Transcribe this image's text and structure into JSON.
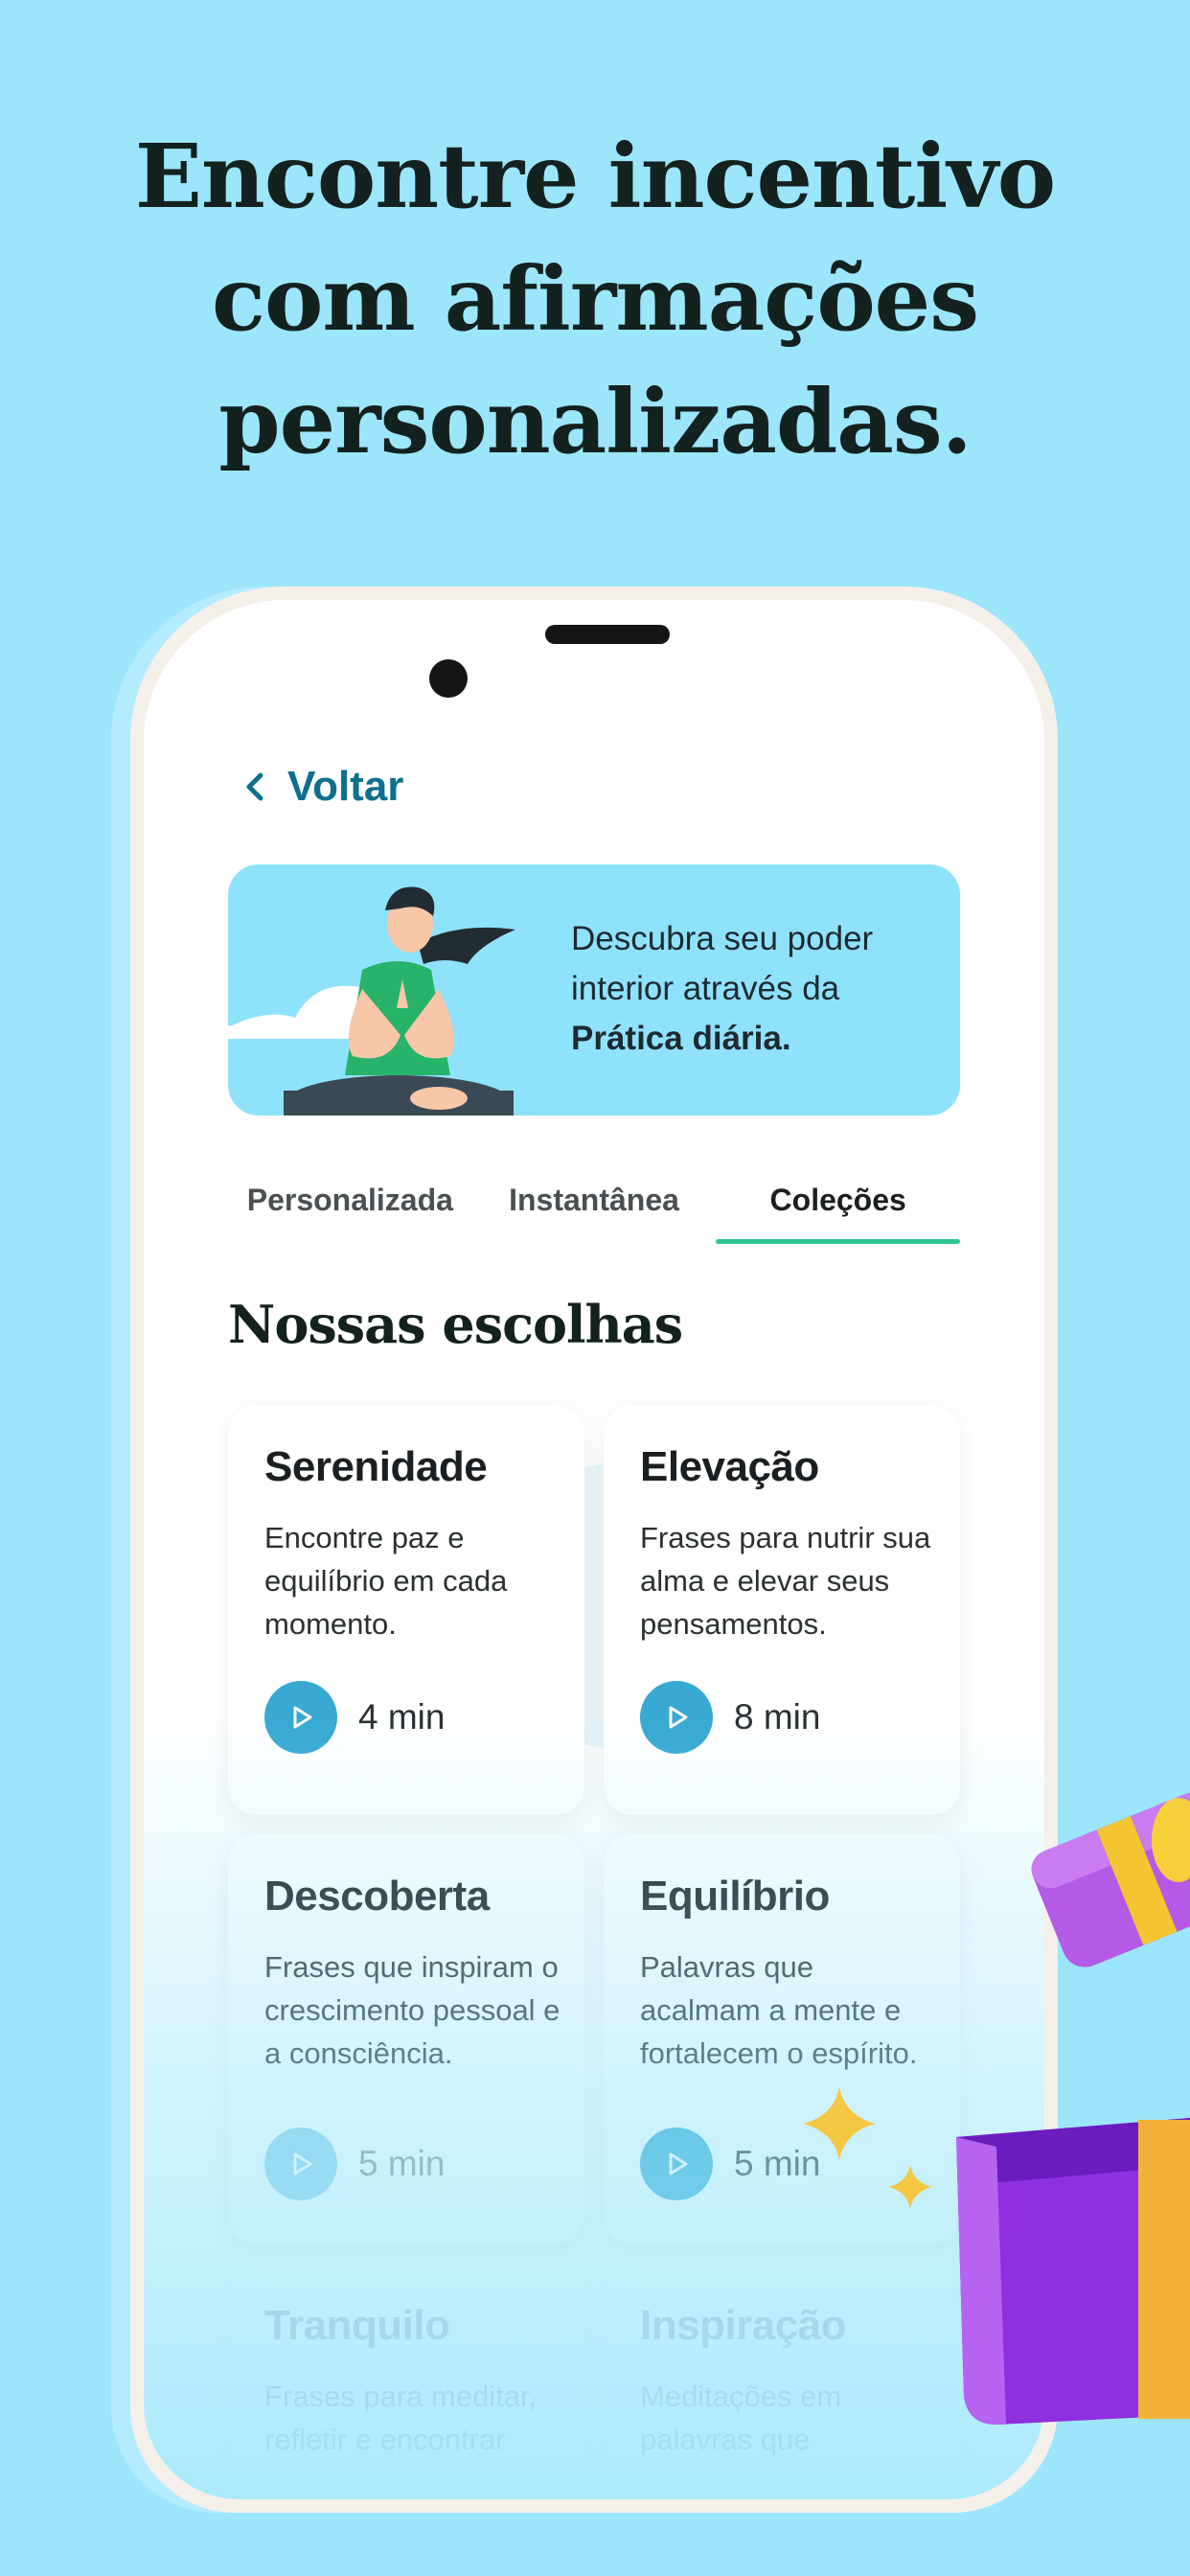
{
  "headline": [
    "Encontre incentivo",
    "com afirmações",
    "personalizadas."
  ],
  "nav": {
    "back_label": "Voltar"
  },
  "banner": {
    "line1": "Descubra seu poder",
    "line2": "interior através da",
    "line3_bold": "Prática diária."
  },
  "tabs": [
    {
      "label": "Personalizada",
      "active": false
    },
    {
      "label": "Instantânea",
      "active": false
    },
    {
      "label": "Coleções",
      "active": true
    }
  ],
  "section_title": "Nossas escolhas",
  "cards": [
    {
      "title": "Serenidade",
      "desc": "Encontre paz e equilíbrio em cada momento.",
      "duration": "4 min"
    },
    {
      "title": "Elevação",
      "desc": "Frases para nutrir sua alma e elevar seus pensamentos.",
      "duration": "8 min"
    },
    {
      "title": "Descoberta",
      "desc": "Frases que inspiram o crescimento pessoal e a consciência.",
      "duration": "5 min"
    },
    {
      "title": "Equilíbrio",
      "desc": "Palavras que acalmam a mente e fortalecem o espírito.",
      "duration": "5 min"
    },
    {
      "title": "Tranquilo",
      "desc": "Frases para meditar, refletir e encontrar"
    },
    {
      "title": "Inspiração",
      "desc": "Meditações em palavras que"
    }
  ],
  "colors": {
    "background": "#9ce6fc",
    "accent_blue": "#0e6f8e",
    "play_button": "#37a9d2",
    "tab_indicator": "#2fc395",
    "banner": "#8fe2fb"
  },
  "icons": [
    "chevron-left-icon",
    "play-icon",
    "gift-box-icon",
    "sparkle-icon"
  ]
}
